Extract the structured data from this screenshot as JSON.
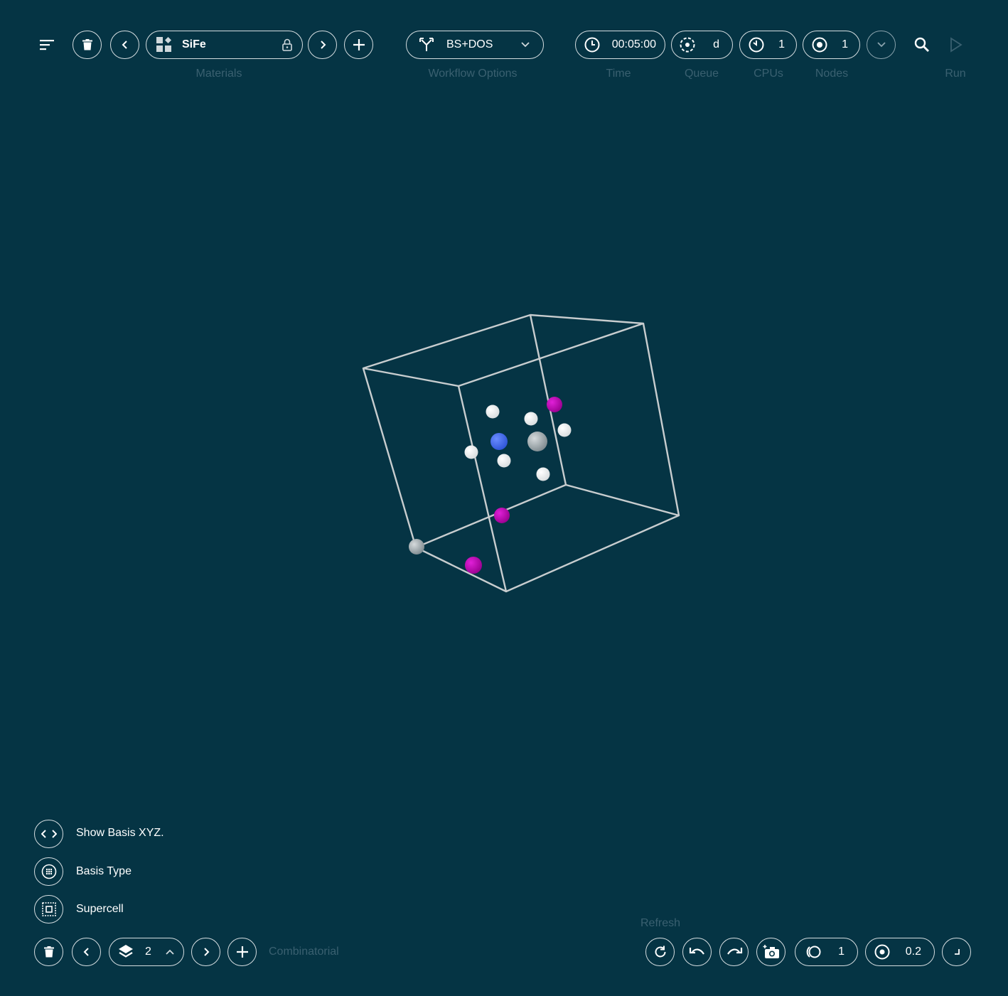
{
  "toolbar": {
    "material_name": "SiFe",
    "materials_label": "Materials",
    "workflow_name": "BS+DOS",
    "workflow_label": "Workflow Options",
    "time_value": "00:05:00",
    "time_label": "Time",
    "queue_value": "d",
    "queue_label": "Queue",
    "cpus_value": "1",
    "cpus_label": "CPUs",
    "nodes_value": "1",
    "nodes_label": "Nodes",
    "run_label": "Run"
  },
  "side_menu": {
    "show_basis": "Show Basis XYZ.",
    "basis_type": "Basis Type",
    "supercell": "Supercell"
  },
  "bottom": {
    "layer_value": "2",
    "combinatorial_label": "Combinatorial",
    "refresh_label": "Refresh",
    "repetition_value": "1",
    "radius_value": "0.2"
  },
  "colors": {
    "background": "#053444",
    "border": "#d5dde0",
    "muted_text": "#3a6070",
    "atom_white": "#ffffff",
    "atom_magenta": "#c800c0",
    "atom_blue": "#3f6af0",
    "atom_gray": "#9aa6ab"
  },
  "icons": [
    "menu-icon",
    "trash-icon",
    "chevron-left-icon",
    "materials-grid-icon",
    "lock-icon",
    "chevron-right-icon",
    "plus-icon",
    "workflow-branch-icon",
    "chevron-down-icon",
    "clock-icon",
    "queue-icon",
    "cpu-timer-icon",
    "nodes-icon",
    "search-icon",
    "play-icon",
    "code-icon",
    "basis-type-icon",
    "supercell-icon",
    "layers-icon",
    "chevron-up-icon",
    "refresh-icon",
    "undo-icon",
    "redo-icon",
    "camera-icon",
    "repetition-icon",
    "radius-icon",
    "corner-icon"
  ]
}
